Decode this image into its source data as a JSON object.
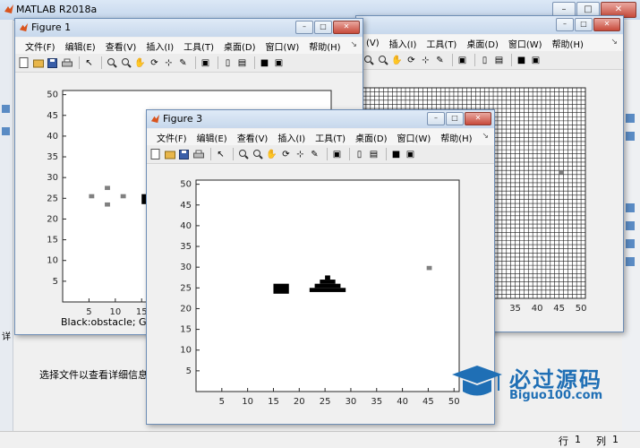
{
  "main": {
    "title": "MATLAB R2018a",
    "detail_text": "选择文件以查看详细信息",
    "status_row_label": "行",
    "status_row_value": "1",
    "status_col_label": "列",
    "status_col_value": "1",
    "left_marker": "详"
  },
  "menu": {
    "items": [
      "文件(F)",
      "编辑(E)",
      "查看(V)",
      "插入(I)",
      "工具(T)",
      "桌面(D)",
      "窗口(W)",
      "帮助(H)"
    ],
    "partial_items": [
      "(V)",
      "插入(I)",
      "工具(T)",
      "桌面(D)",
      "窗口(W)",
      "帮助(H)"
    ]
  },
  "toolbar_icons": [
    "new-icon",
    "open-icon",
    "save-icon",
    "print-icon",
    "pointer-icon",
    "zoom-in-icon",
    "zoom-out-icon",
    "pan-icon",
    "rotate-icon",
    "datatip-icon",
    "brush-icon",
    "link-icon",
    "colorbar-icon",
    "legend-icon",
    "hide-icon",
    "show-icon"
  ],
  "fig1": {
    "title": "Figure 1",
    "yticks": [
      "50",
      "45",
      "40",
      "35",
      "30",
      "25",
      "20",
      "15",
      "10",
      "5"
    ],
    "xticks": [
      "5",
      "10",
      "15"
    ],
    "caption": "Black:obstacle; Gray:"
  },
  "fig2": {
    "xticks": [
      "35",
      "40",
      "45",
      "50"
    ]
  },
  "fig3": {
    "title": "Figure 3",
    "yticks": [
      "50",
      "45",
      "40",
      "35",
      "30",
      "25",
      "20",
      "15",
      "10",
      "5"
    ],
    "xticks": [
      "5",
      "10",
      "15",
      "20",
      "25",
      "30",
      "35",
      "40",
      "45",
      "50"
    ]
  },
  "watermark": {
    "cn": "必过源码",
    "en": "Biguo100.com"
  },
  "colors": {
    "obstacle": "#000000",
    "gray_point": "#808080",
    "grid": "#1a1a1a"
  }
}
